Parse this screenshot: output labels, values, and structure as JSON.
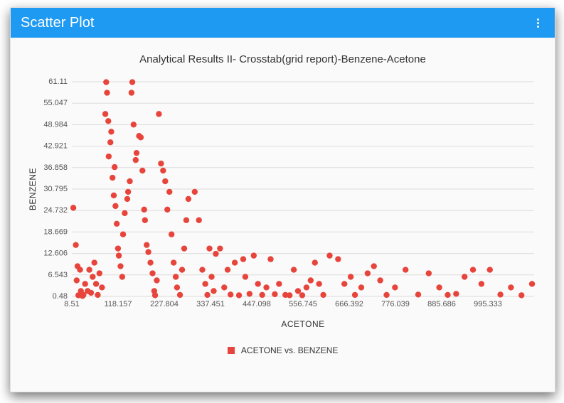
{
  "header": {
    "title": "Scatter Plot"
  },
  "chart_data": {
    "type": "scatter",
    "title": "Analytical Results II- Crosstab(grid report)-Benzene-Acetone",
    "xlabel": "ACETONE",
    "ylabel": "BENZENE",
    "xlim": [
      8.51,
      1104.98
    ],
    "ylim": [
      0.48,
      61.11
    ],
    "x_ticks": [
      8.51,
      118.157,
      227.804,
      337.451,
      447.098,
      556.745,
      666.392,
      776.039,
      885.686,
      995.333
    ],
    "y_ticks": [
      0.48,
      6.543,
      12.606,
      18.669,
      24.732,
      30.795,
      36.858,
      42.921,
      48.984,
      55.047,
      61.11
    ],
    "legend": [
      {
        "name": "ACETONE vs. BENZENE",
        "color": "#e7453c"
      }
    ],
    "series": [
      {
        "name": "ACETONE vs. BENZENE",
        "points": [
          [
            12,
            25.5
          ],
          [
            18,
            15
          ],
          [
            20,
            5
          ],
          [
            22,
            9
          ],
          [
            24,
            0.8
          ],
          [
            28,
            8
          ],
          [
            30,
            2
          ],
          [
            34,
            0.6
          ],
          [
            36,
            0.9
          ],
          [
            40,
            4
          ],
          [
            46,
            2
          ],
          [
            50,
            8
          ],
          [
            54,
            1.5
          ],
          [
            58,
            6
          ],
          [
            62,
            10
          ],
          [
            66,
            4
          ],
          [
            70,
            0.9
          ],
          [
            74,
            7
          ],
          [
            80,
            3
          ],
          [
            90,
            61
          ],
          [
            92,
            58
          ],
          [
            88,
            52
          ],
          [
            95,
            50
          ],
          [
            100,
            44
          ],
          [
            96,
            40
          ],
          [
            102,
            47
          ],
          [
            105,
            34
          ],
          [
            110,
            37
          ],
          [
            108,
            29
          ],
          [
            112,
            26
          ],
          [
            115,
            21
          ],
          [
            118,
            14
          ],
          [
            120,
            12
          ],
          [
            124,
            9
          ],
          [
            128,
            6
          ],
          [
            130,
            18
          ],
          [
            134,
            24
          ],
          [
            140,
            28
          ],
          [
            142,
            30
          ],
          [
            146,
            33
          ],
          [
            150,
            58
          ],
          [
            152,
            61
          ],
          [
            155,
            49
          ],
          [
            160,
            39
          ],
          [
            162,
            41
          ],
          [
            168,
            45.8
          ],
          [
            172,
            45.4
          ],
          [
            176,
            36
          ],
          [
            180,
            25
          ],
          [
            182,
            22
          ],
          [
            186,
            15
          ],
          [
            190,
            13
          ],
          [
            195,
            10
          ],
          [
            200,
            7
          ],
          [
            204,
            2
          ],
          [
            206,
            0.8
          ],
          [
            210,
            5
          ],
          [
            215,
            52
          ],
          [
            220,
            38
          ],
          [
            225,
            36
          ],
          [
            230,
            33
          ],
          [
            235,
            25
          ],
          [
            240,
            30
          ],
          [
            245,
            18
          ],
          [
            250,
            10
          ],
          [
            255,
            6
          ],
          [
            258,
            3
          ],
          [
            265,
            0.9
          ],
          [
            270,
            8
          ],
          [
            275,
            14
          ],
          [
            280,
            22
          ],
          [
            285,
            28
          ],
          [
            300,
            30
          ],
          [
            310,
            22
          ],
          [
            318,
            8
          ],
          [
            325,
            4
          ],
          [
            330,
            0.9
          ],
          [
            335,
            14
          ],
          [
            340,
            6
          ],
          [
            345,
            2
          ],
          [
            350,
            12.5
          ],
          [
            360,
            14
          ],
          [
            370,
            3
          ],
          [
            378,
            8
          ],
          [
            385,
            1
          ],
          [
            395,
            10
          ],
          [
            405,
            0.8
          ],
          [
            415,
            11
          ],
          [
            420,
            6
          ],
          [
            430,
            1.2
          ],
          [
            440,
            12
          ],
          [
            450,
            4
          ],
          [
            460,
            0.9
          ],
          [
            470,
            3
          ],
          [
            480,
            11
          ],
          [
            490,
            1.1
          ],
          [
            500,
            4
          ],
          [
            515,
            0.9
          ],
          [
            525,
            0.8
          ],
          [
            535,
            8
          ],
          [
            545,
            2
          ],
          [
            555,
            0.8
          ],
          [
            565,
            3
          ],
          [
            575,
            5
          ],
          [
            585,
            10
          ],
          [
            595,
            4
          ],
          [
            605,
            0.9
          ],
          [
            620,
            12
          ],
          [
            640,
            11
          ],
          [
            655,
            4
          ],
          [
            670,
            6
          ],
          [
            680,
            0.9
          ],
          [
            695,
            3
          ],
          [
            710,
            7
          ],
          [
            725,
            9
          ],
          [
            740,
            5
          ],
          [
            755,
            0.9
          ],
          [
            775,
            3
          ],
          [
            800,
            8
          ],
          [
            830,
            1
          ],
          [
            855,
            7
          ],
          [
            880,
            3
          ],
          [
            900,
            0.9
          ],
          [
            920,
            1.2
          ],
          [
            940,
            6
          ],
          [
            960,
            8
          ],
          [
            980,
            4
          ],
          [
            1000,
            8
          ],
          [
            1025,
            1
          ],
          [
            1050,
            3
          ],
          [
            1075,
            0.8
          ],
          [
            1100,
            4
          ]
        ]
      }
    ]
  }
}
